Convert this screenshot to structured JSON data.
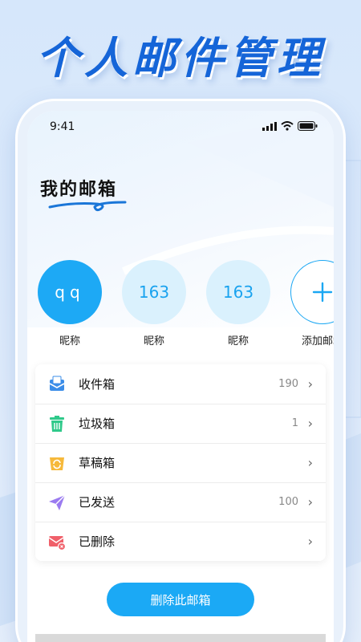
{
  "promo": {
    "title": "个人邮件管理"
  },
  "status_bar": {
    "time": "9:41"
  },
  "page": {
    "heading": "我的邮箱"
  },
  "accounts": [
    {
      "label": "qq",
      "name": "昵称",
      "active": true
    },
    {
      "label": "163",
      "name": "昵称",
      "active": false
    },
    {
      "label": "163",
      "name": "昵称",
      "active": false
    },
    {
      "label": "+",
      "name": "添加邮箱",
      "active": false
    }
  ],
  "folders": [
    {
      "label": "收件箱",
      "count": "190",
      "icon": "inbox-icon"
    },
    {
      "label": "垃圾箱",
      "count": "1",
      "icon": "trash-icon"
    },
    {
      "label": "草稿箱",
      "count": "",
      "icon": "drafts-icon"
    },
    {
      "label": "已发送",
      "count": "100",
      "icon": "sent-icon"
    },
    {
      "label": "已删除",
      "count": "",
      "icon": "deleted-icon"
    }
  ],
  "actions": {
    "delete_mailbox": "删除此邮箱"
  },
  "colors": {
    "accent": "#1da9f5",
    "title": "#1565d8"
  }
}
